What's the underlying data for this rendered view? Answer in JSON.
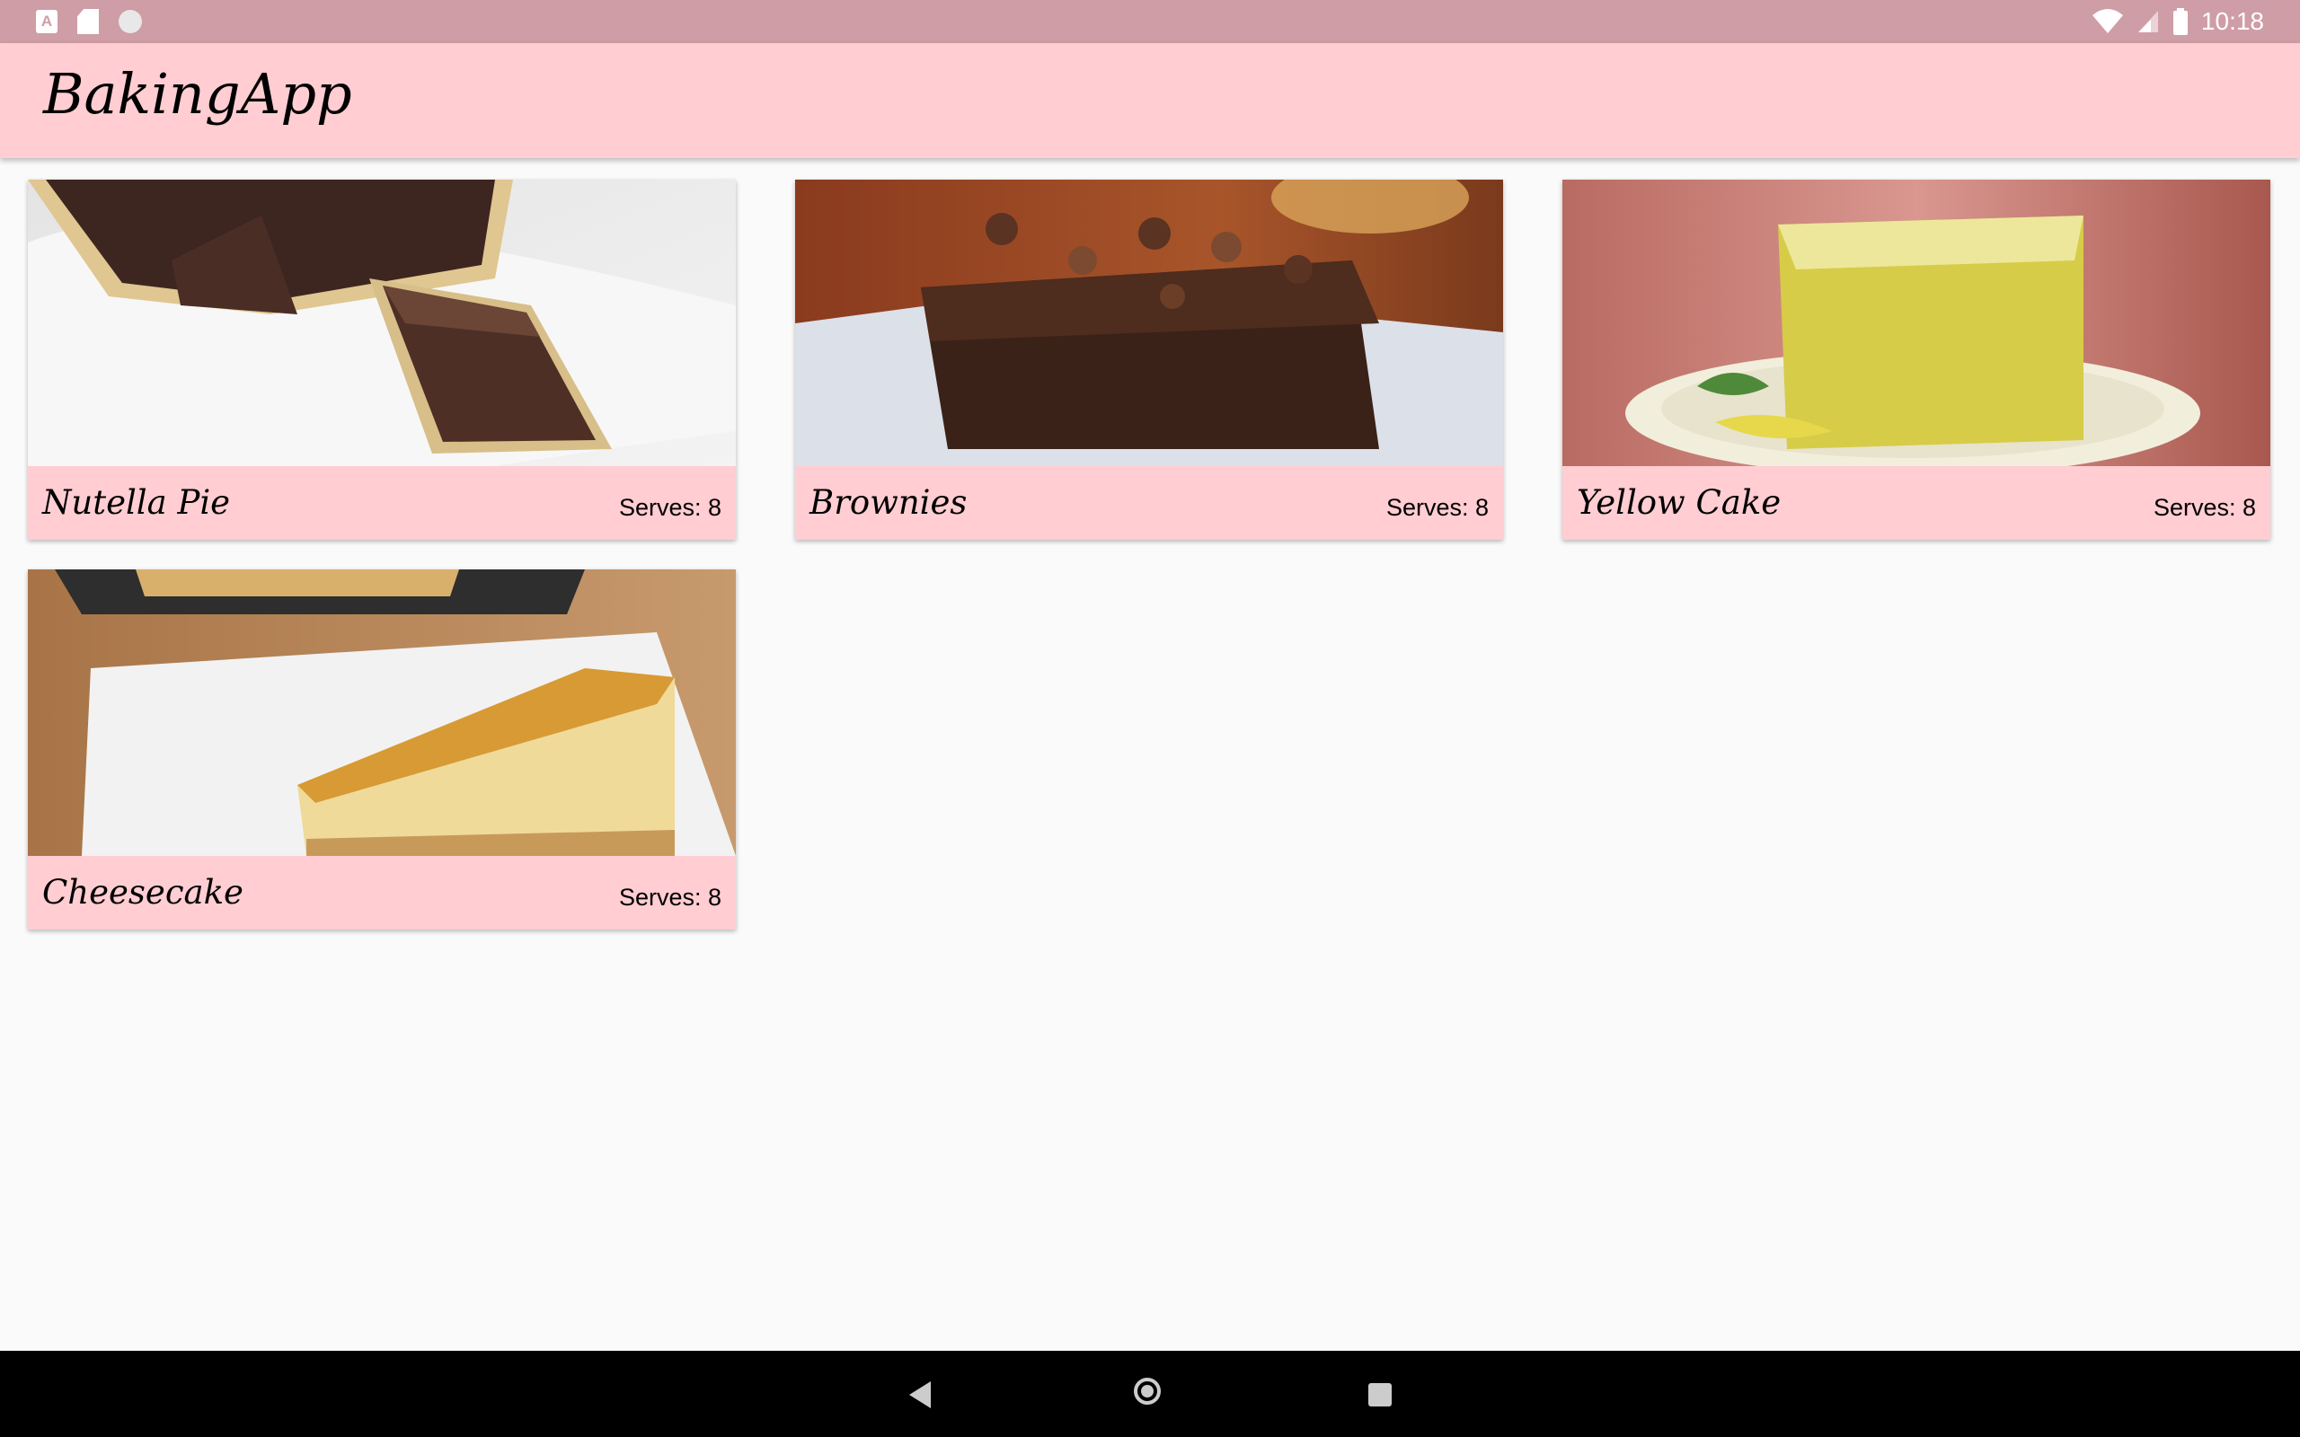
{
  "status_bar": {
    "time": "10:18",
    "left_icons": [
      "text-a-icon",
      "sd-card-icon",
      "circle-icon"
    ],
    "right_icons": [
      "wifi-icon",
      "cellular-signal-icon",
      "battery-icon"
    ],
    "a_glyph": "A"
  },
  "app": {
    "title": "BakingApp",
    "background": "#FFCDD2",
    "status_color": "#CF9DA6"
  },
  "recipes": [
    {
      "name": "Nutella Pie",
      "serves": "Serves: 8",
      "image": "nutella-pie-photo"
    },
    {
      "name": "Brownies",
      "serves": "Serves: 8",
      "image": "brownies-photo"
    },
    {
      "name": "Yellow Cake",
      "serves": "Serves: 8",
      "image": "yellow-cake-photo"
    },
    {
      "name": "Cheesecake",
      "serves": "Serves: 8",
      "image": "cheesecake-photo"
    }
  ],
  "nav_bar": {
    "buttons": [
      "back-icon",
      "home-icon",
      "recents-icon"
    ]
  }
}
